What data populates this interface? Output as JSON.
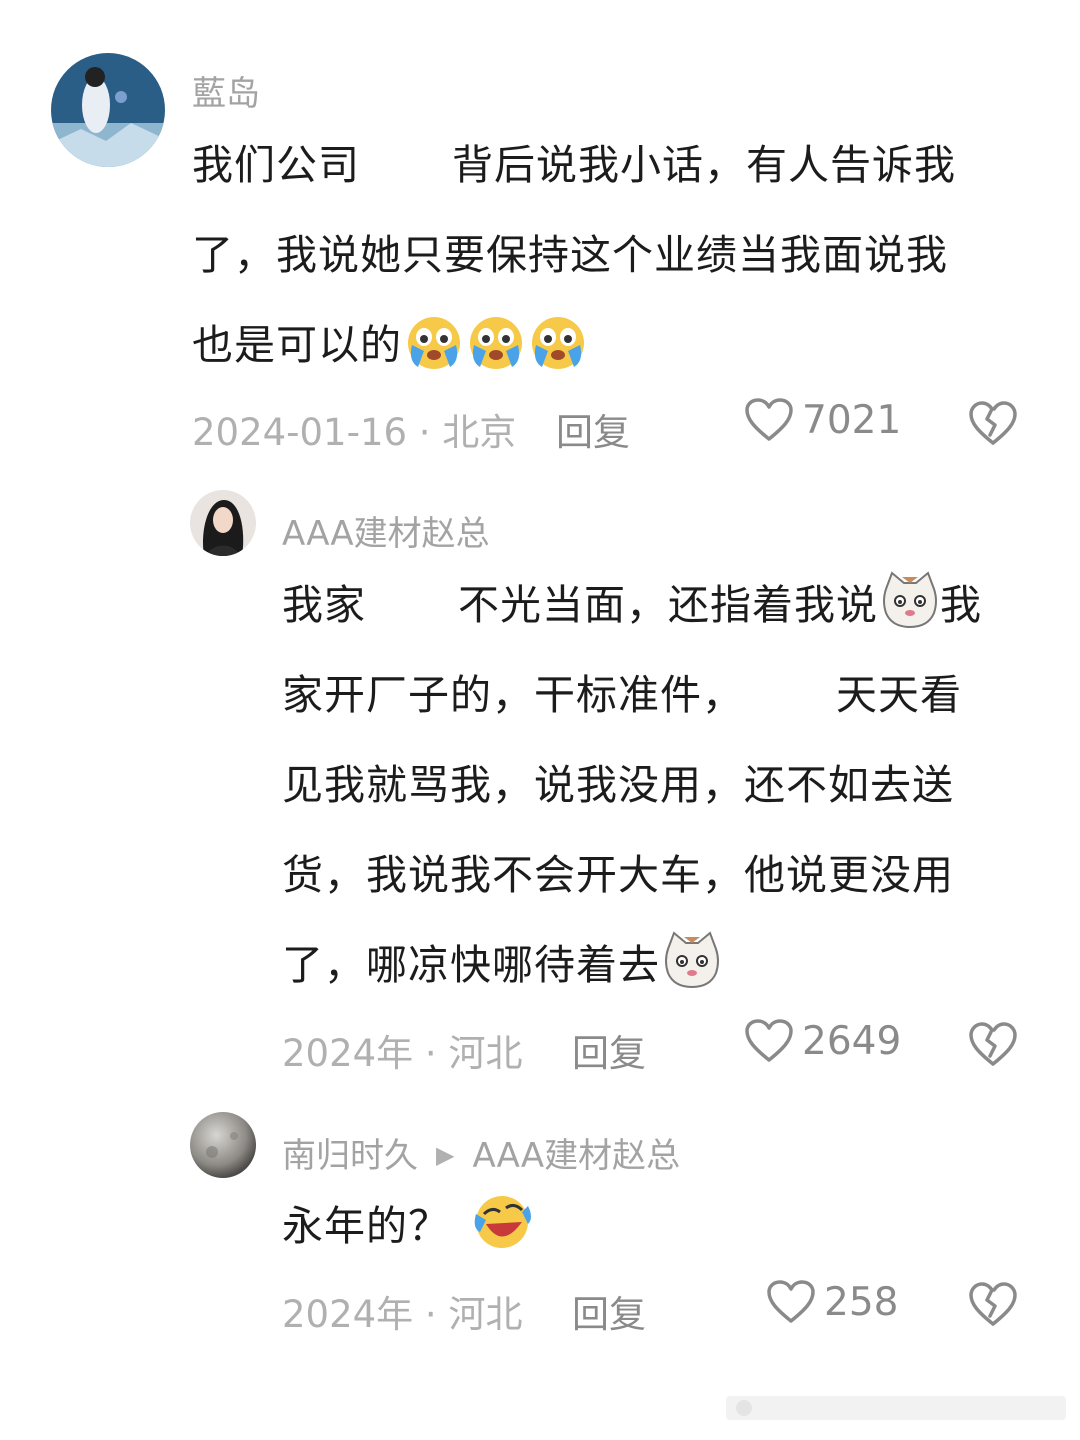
{
  "comments": [
    {
      "username": "藍岛",
      "lines": [
        "我们公司",
        "背后说我小话，有人告诉我",
        "了，我说她只要保持这个业绩当我面说我",
        "也是可以的"
      ],
      "emoji": "crying-face-icon",
      "date_location": "2024-01-16 · 北京",
      "reply_label": "回复",
      "likes": "7021"
    },
    {
      "username": "AAA建材赵总",
      "lines": [
        "我家",
        "不光当面，还指着我说",
        "我",
        "家开厂子的，干标准件，",
        "天天看",
        "见我就骂我，说我没用，还不如去送",
        "货，我说我不会开大车，他说更没用",
        "了，哪凉快哪待着去"
      ],
      "emoji": "cat-face-icon",
      "date_location": "2024年 · 河北",
      "reply_label": "回复",
      "likes": "2649"
    },
    {
      "username": "南归时久",
      "reply_to": "AAA建材赵总",
      "lines": [
        "永年的？"
      ],
      "emoji": "laughing-crying-face-icon",
      "date_location": "2024年 · 河北",
      "reply_label": "回复",
      "likes": "258"
    }
  ]
}
